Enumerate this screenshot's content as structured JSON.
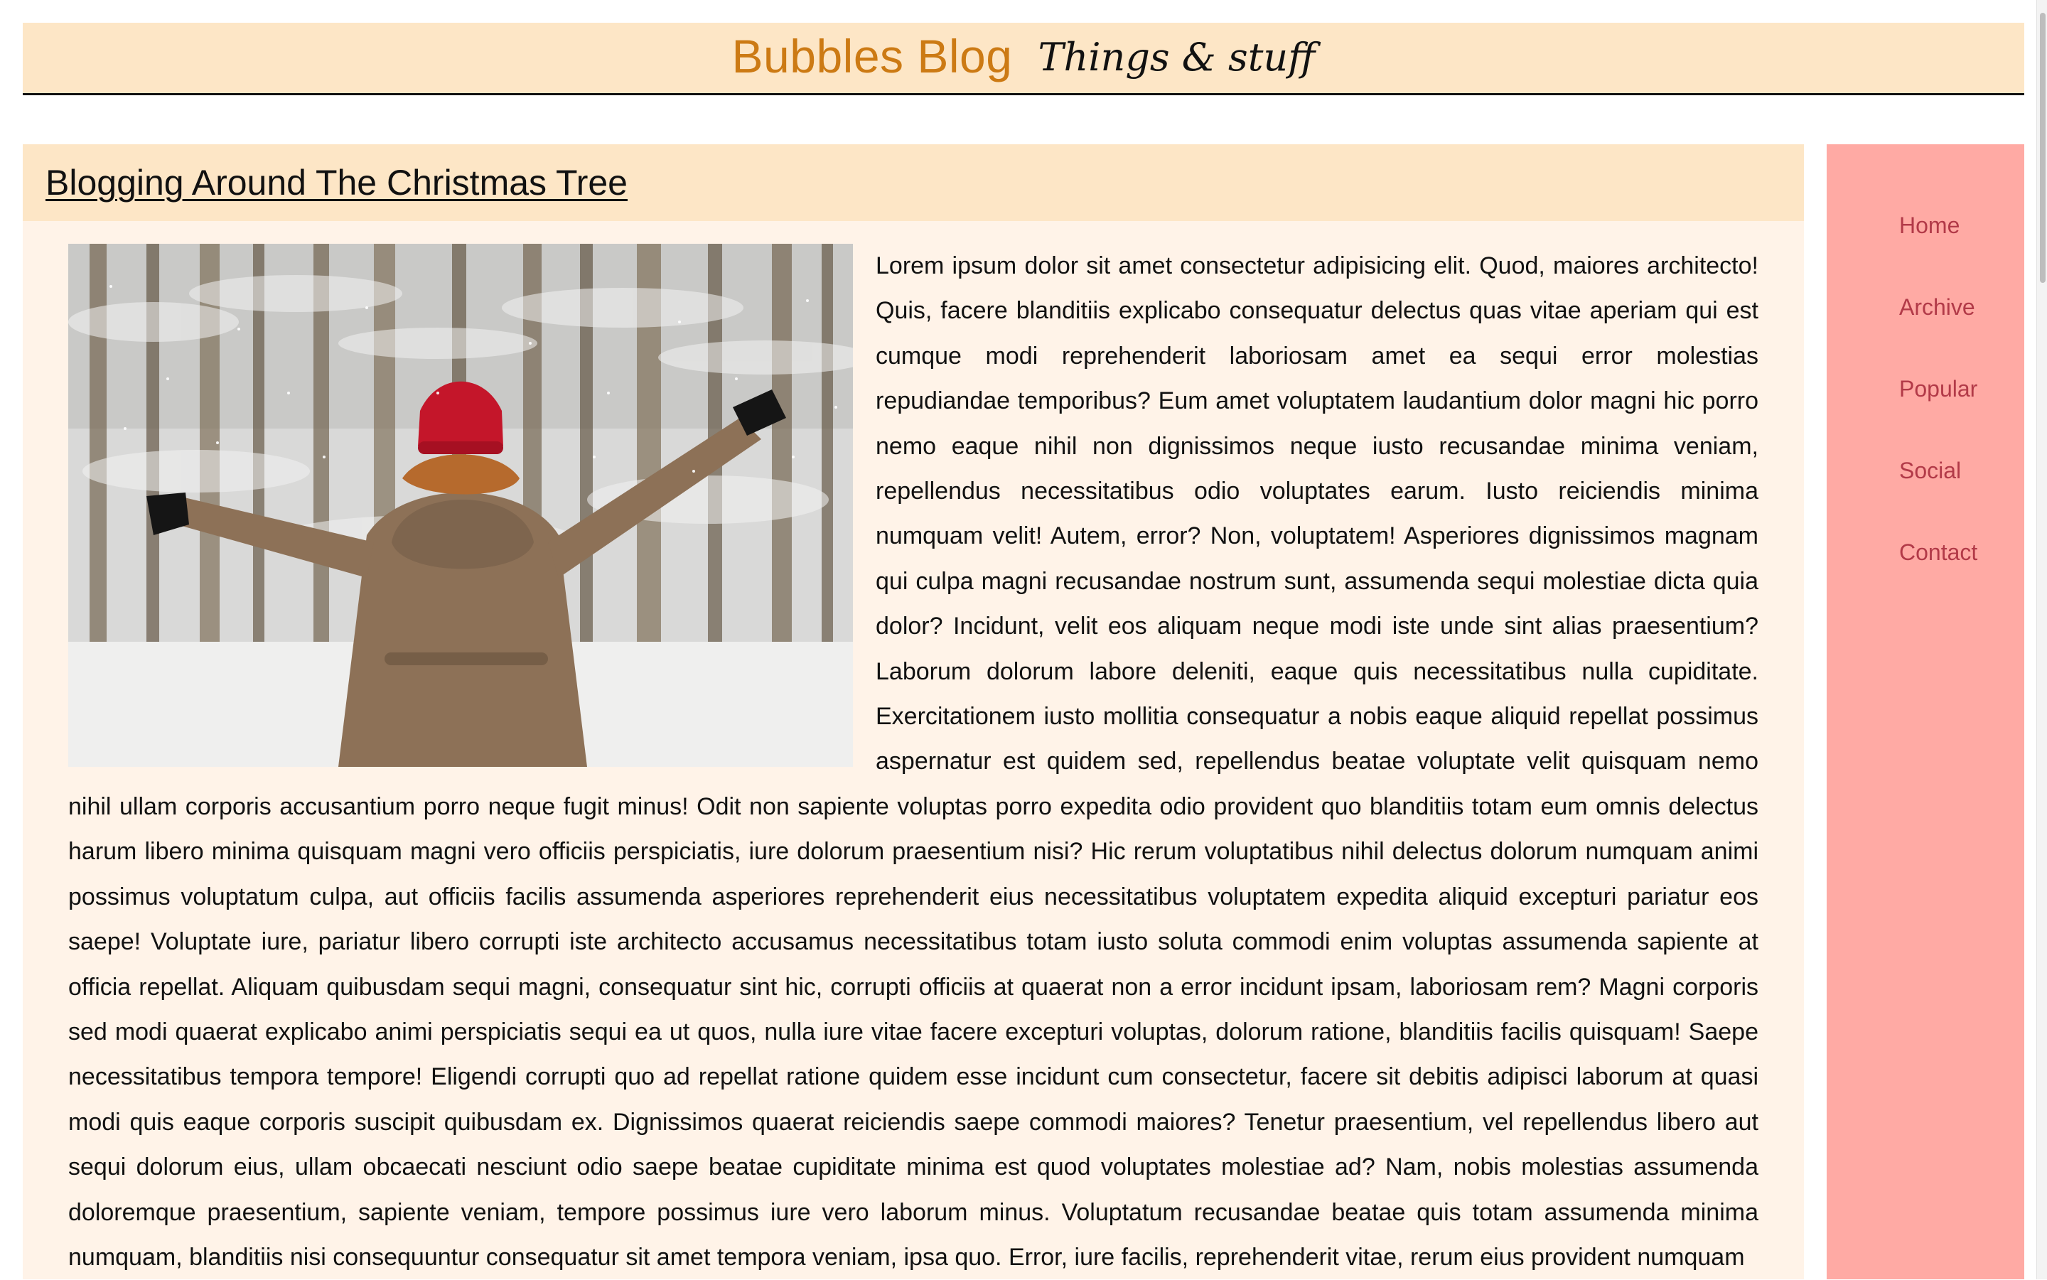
{
  "site": {
    "title": "Bubbles Blog",
    "tagline": "Things & stuff",
    "colors": {
      "header_bg": "#fde6c6",
      "brand_color": "#cc7a14",
      "content_bg": "#fff3e8",
      "sidebar_bg": "#ffaaa4",
      "nav_link_color": "#b23a48",
      "text_color": "#111111"
    }
  },
  "post": {
    "title": "Blogging Around The Christmas Tree",
    "image": {
      "icon": "photo-icon"
    },
    "body": "Lorem ipsum dolor sit amet consectetur adipisicing elit. Quod, maiores architecto! Quis, facere blanditiis explicabo consequatur delectus quas vitae aperiam qui est cumque modi reprehenderit laboriosam amet ea sequi error molestias repudiandae temporibus? Eum amet voluptatem laudantium dolor magni hic porro nemo eaque nihil non dignissimos neque iusto recusandae minima veniam, repellendus necessitatibus odio voluptates earum. Iusto reiciendis minima numquam velit! Autem, error? Non, voluptatem! Asperiores dignissimos magnam qui culpa magni recusandae nostrum sunt, assumenda sequi molestiae dicta quia dolor? Incidunt, velit eos aliquam neque modi iste unde sint alias praesentium? Laborum dolorum labore deleniti, eaque quis necessitatibus nulla cupiditate. Exercitationem iusto mollitia consequatur a nobis eaque aliquid repellat possimus aspernatur est quidem sed, repellendus beatae voluptate velit quisquam nemo nihil ullam corporis accusantium porro neque fugit minus! Odit non sapiente voluptas porro expedita odio provident quo blanditiis totam eum omnis delectus harum libero minima quisquam magni vero officiis perspiciatis, iure dolorum praesentium nisi? Hic rerum voluptatibus nihil delectus dolorum numquam animi possimus voluptatum culpa, aut officiis facilis assumenda asperiores reprehenderit eius necessitatibus voluptatem expedita aliquid excepturi pariatur eos saepe! Voluptate iure, pariatur libero corrupti iste architecto accusamus necessitatibus totam iusto soluta commodi enim voluptas assumenda sapiente at officia repellat. Aliquam quibusdam sequi magni, consequatur sint hic, corrupti officiis at quaerat non a error incidunt ipsam, laboriosam rem? Magni corporis sed modi quaerat explicabo animi perspiciatis sequi ea ut quos, nulla iure vitae facere excepturi voluptas, dolorum ratione, blanditiis facilis quisquam! Saepe necessitatibus tempora tempore! Eligendi corrupti quo ad repellat ratione quidem esse incidunt cum consectetur, facere sit debitis adipisci laborum at quasi modi quis eaque corporis suscipit quibusdam ex. Dignissimos quaerat reiciendis saepe commodi maiores? Tenetur praesentium, vel repellendus libero aut sequi dolorum eius, ullam obcaecati nesciunt odio saepe beatae cupiditate minima est quod voluptates molestiae ad? Nam, nobis molestias assumenda doloremque praesentium, sapiente veniam, tempore possimus iure vero laborum minus. Voluptatum recusandae beatae quis totam assumenda minima numquam, blanditiis nisi consequuntur consequatur sit amet tempora veniam, ipsa quo. Error, iure facilis, reprehenderit vitae, rerum eius provident numquam"
  },
  "sidebar": {
    "items": [
      {
        "label": "Home"
      },
      {
        "label": "Archive"
      },
      {
        "label": "Popular"
      },
      {
        "label": "Social"
      },
      {
        "label": "Contact"
      }
    ]
  }
}
